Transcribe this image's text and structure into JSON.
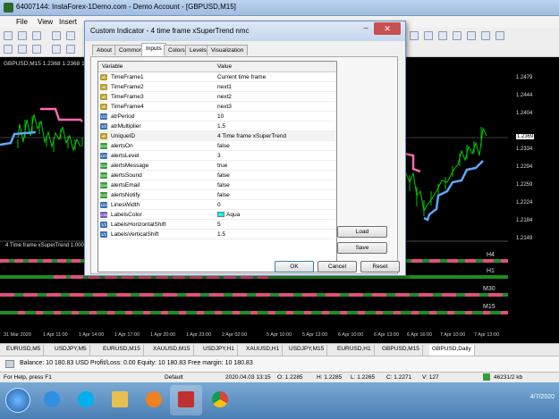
{
  "window": {
    "title": "64007144: InstaForex-1Demo.com - Demo Account - [GBPUSD,M15]"
  },
  "menu": [
    "File",
    "View",
    "Insert"
  ],
  "chart": {
    "symbol_info": "GBPUSD,M15 1.2368 1.2368 1.2",
    "indicator_label": "4 Time frame xSuperTrend 1.0000",
    "prices": [
      "1.2479",
      "1.2444",
      "1.2404",
      "1.2369",
      "1.2334",
      "1.2294",
      "1.2259",
      "1.2224",
      "1.2184",
      "1.2149"
    ],
    "timeframe_labels": [
      "H4",
      "H1",
      "M30",
      "M15"
    ],
    "time_labels": [
      "31 Mar 2020",
      "1 Apr 11:00",
      "1 Apr 14:00",
      "1 Apr 17:00",
      "1 Apr 20:00",
      "1 Apr 23:00",
      "2 Apr 02:00",
      "5 Apr 10:00",
      "5 Apr 13:00",
      "6 Apr 10:00",
      "6 Apr 13:00",
      "6 Apr 16:00",
      "7 Apr 10:00",
      "7 Apr 13:00"
    ]
  },
  "chart_tabs": [
    "EURUSD,M5",
    "USDJPY,M5",
    "EURUSD,M15",
    "XAUUSD,M15",
    "USDJPY,H1",
    "XAUUSD,H1",
    "USDJPY,M15",
    "EURUSD,H1",
    "GBPUSD,M15",
    "GBPUSD,Daily"
  ],
  "terminal": {
    "text": "Balance: 10 180.83 USD  Profit/Loss: 0.00  Equity: 10 180.83  Free margin: 10 180.83"
  },
  "statusbar": {
    "help": "For Help, press F1",
    "profile": "Default",
    "datetime": "2020.04.03 13:15",
    "open": "O: 1.2285",
    "high": "H: 1.2285",
    "low": "L: 1.2265",
    "close": "C: 1.2271",
    "volume": "V: 127",
    "traffic": "46231/2 kb"
  },
  "taskbar": {
    "time": "4/7/2020"
  },
  "dialog": {
    "title": "Custom Indicator - 4 time frame xSuperTrend nmc",
    "close": "✕",
    "minimize": "–",
    "tabs": [
      "About",
      "Common",
      "Inputs",
      "Colors",
      "Levels",
      "Visualization"
    ],
    "active_tab": "Inputs",
    "col_variable": "Variable",
    "col_value": "Value",
    "rows": [
      {
        "icon": "ab",
        "name": "TimeFrame1",
        "value": "Current time frame"
      },
      {
        "icon": "ab",
        "name": "TimeFrame2",
        "value": "next1"
      },
      {
        "icon": "ab",
        "name": "TimeFrame3",
        "value": "next2"
      },
      {
        "icon": "ab",
        "name": "TimeFrame4",
        "value": "next3"
      },
      {
        "icon": "123",
        "name": "atrPeriod",
        "value": "10"
      },
      {
        "icon": "1/2",
        "name": "atrMultiplier",
        "value": "1.5"
      },
      {
        "icon": "ab",
        "name": "UniqueID",
        "value": "4 Time frame xSuperTrend"
      },
      {
        "icon": "bool",
        "name": "alertsOn",
        "value": "false"
      },
      {
        "icon": "123",
        "name": "alertsLevel",
        "value": "3"
      },
      {
        "icon": "bool",
        "name": "alertsMessage",
        "value": "true"
      },
      {
        "icon": "bool",
        "name": "alertsSound",
        "value": "false"
      },
      {
        "icon": "bool",
        "name": "alertsEmail",
        "value": "false"
      },
      {
        "icon": "bool",
        "name": "alertsNotify",
        "value": "false"
      },
      {
        "icon": "123",
        "name": "LinesWidth",
        "value": "0"
      },
      {
        "icon": "color",
        "name": "LabelsColor",
        "value": "Aqua"
      },
      {
        "icon": "1/2",
        "name": "LabelsHorizontalShift",
        "value": "5"
      },
      {
        "icon": "1/2",
        "name": "LabelsVerticalShift",
        "value": "1.5"
      }
    ],
    "load": "Load",
    "save": "Save",
    "ok": "OK",
    "cancel": "Cancel",
    "reset": "Reset"
  },
  "colors": {
    "supertrend_up": "#ff69b4",
    "supertrend_down": "#5aaaff",
    "candles": "#00cc00",
    "strip_green": "#1e8c1e",
    "strip_pink": "#e0507a",
    "labels": "#00ffff"
  }
}
